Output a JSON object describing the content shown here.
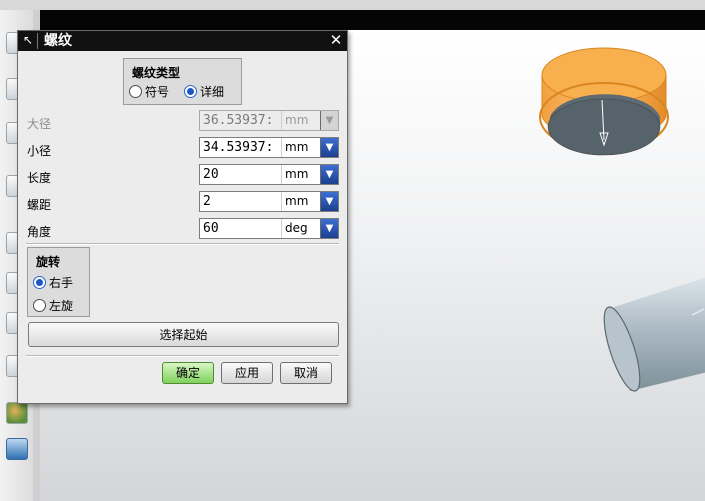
{
  "dialog": {
    "title": "螺纹",
    "thread_type": {
      "title": "螺纹类型",
      "options": [
        "符号",
        "详细"
      ],
      "selected": "详细"
    },
    "fields": [
      {
        "label": "大径",
        "value": "36.53937:",
        "unit": "mm",
        "enabled": false
      },
      {
        "label": "小径",
        "value": "34.53937:",
        "unit": "mm",
        "enabled": true
      },
      {
        "label": "长度",
        "value": "20",
        "unit": "mm",
        "enabled": true
      },
      {
        "label": "螺距",
        "value": "2",
        "unit": "mm",
        "enabled": true
      },
      {
        "label": "角度",
        "value": "60",
        "unit": "deg",
        "enabled": true
      }
    ],
    "rotation": {
      "title": "旋转",
      "options": [
        "右手",
        "左旋"
      ],
      "selected": "右手"
    },
    "select_start_label": "选择起始",
    "buttons": {
      "ok": "确定",
      "apply": "应用",
      "cancel": "取消"
    }
  },
  "icons": {
    "title_icon": "arrow-pointer-icon",
    "close": "close-icon",
    "dropdown": "dropdown-arrow-icon"
  },
  "colors": {
    "title_bar": "#111111",
    "radio_selected": "#1b56c4",
    "dropdown_button": "#2a55b8",
    "ok_button": "#7fd15d",
    "orange_part": "#f5a23a"
  }
}
